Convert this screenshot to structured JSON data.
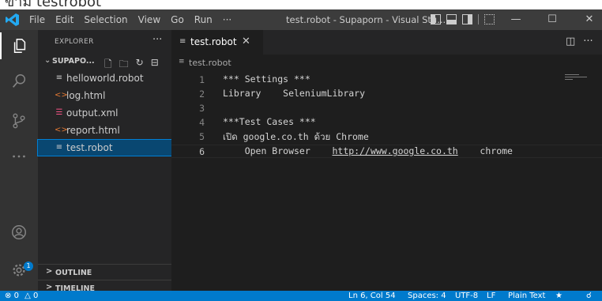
{
  "caption": "ขาม testrobot",
  "titlebar": {
    "menu": [
      "File",
      "Edit",
      "Selection",
      "View",
      "Go",
      "Run",
      "···"
    ],
    "window_title": "test.robot - Supaporn - Visual Stu...",
    "controls": {
      "minimize": "—",
      "maximize": "☐",
      "close": "✕"
    }
  },
  "sidebar": {
    "header": "EXPLORER",
    "header_more": "···",
    "folder": "SUPAPO...",
    "files": [
      {
        "name": "helloworld.robot",
        "icon": "lines-file-icon",
        "glyph": "≡",
        "color": "#cccccc"
      },
      {
        "name": "log.html",
        "icon": "html-file-icon",
        "glyph": "<>",
        "color": "#e37933"
      },
      {
        "name": "output.xml",
        "icon": "rss-file-icon",
        "glyph": "☰",
        "color": "#f55385"
      },
      {
        "name": "report.html",
        "icon": "html-file-icon",
        "glyph": "<>",
        "color": "#e37933"
      },
      {
        "name": "test.robot",
        "icon": "lines-file-icon",
        "glyph": "≡",
        "color": "#cccccc"
      }
    ],
    "selected_index": 4,
    "sections": [
      "OUTLINE",
      "TIMELINE"
    ]
  },
  "activity": {
    "accounts_badge": "1"
  },
  "editor": {
    "tab": {
      "icon_glyph": "≡",
      "name": "test.robot",
      "close": "✕"
    },
    "breadcrumb": "test.robot",
    "lines": [
      {
        "num": "1",
        "text": "*** Settings ***"
      },
      {
        "num": "2",
        "text": "Library    SeleniumLibrary"
      },
      {
        "num": "3",
        "text": ""
      },
      {
        "num": "4",
        "text": "***Test Cases ***"
      },
      {
        "num": "5",
        "text": "เปิด google.co.th ด้วย Chrome"
      },
      {
        "num": "6",
        "text_before": "    Open Browser    ",
        "url": "http://www.google.co.th",
        "text_after": "    chrome"
      }
    ],
    "current_line": 6
  },
  "statusbar": {
    "errors": "0",
    "warnings": "0",
    "position": "Ln 6, Col 54",
    "spaces": "Spaces: 4",
    "encoding": "UTF-8",
    "eol": "LF",
    "language": "Plain Text"
  },
  "colors": {
    "accent": "#007acc",
    "titlebar": "#3c3c3c",
    "sidebar": "#252526",
    "editor": "#1e1e1e",
    "activitybar": "#333333"
  }
}
